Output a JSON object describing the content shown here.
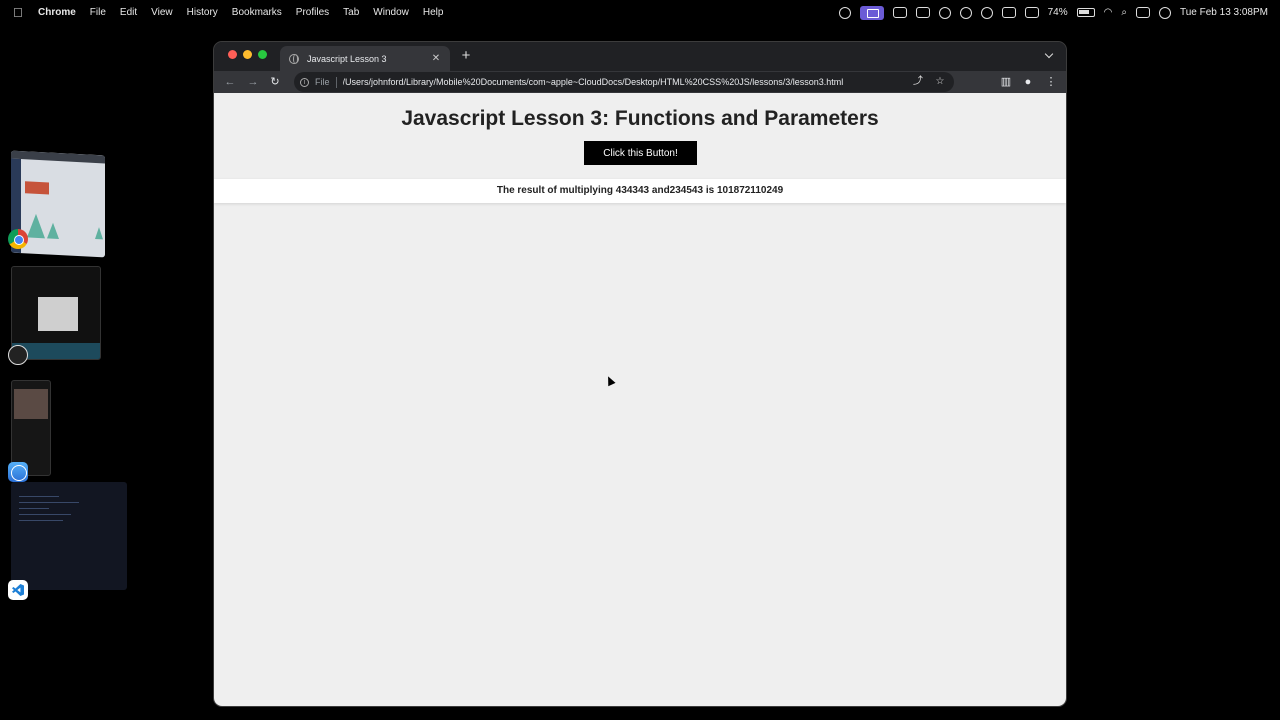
{
  "menubar": {
    "app_name": "Chrome",
    "menus": [
      "File",
      "Edit",
      "View",
      "History",
      "Bookmarks",
      "Profiles",
      "Tab",
      "Window",
      "Help"
    ],
    "battery_percent": "74%",
    "datetime": "Tue Feb 13  3:08PM"
  },
  "browser": {
    "tab_title": "Javascript Lesson 3",
    "scheme_label": "File",
    "url": "/Users/johnford/Library/Mobile%20Documents/com~apple~CloudDocs/Desktop/HTML%20CSS%20JS/lessons/3/lesson3.html"
  },
  "page": {
    "heading": "Javascript Lesson 3: Functions and Parameters",
    "button_label": "Click this Button!",
    "result_text": "The result of multiplying 434343 and234543 is 101872110249"
  },
  "dock": {
    "apps": [
      "chrome-icon",
      "obs-icon",
      "safari-icon",
      "vscode-icon"
    ]
  }
}
